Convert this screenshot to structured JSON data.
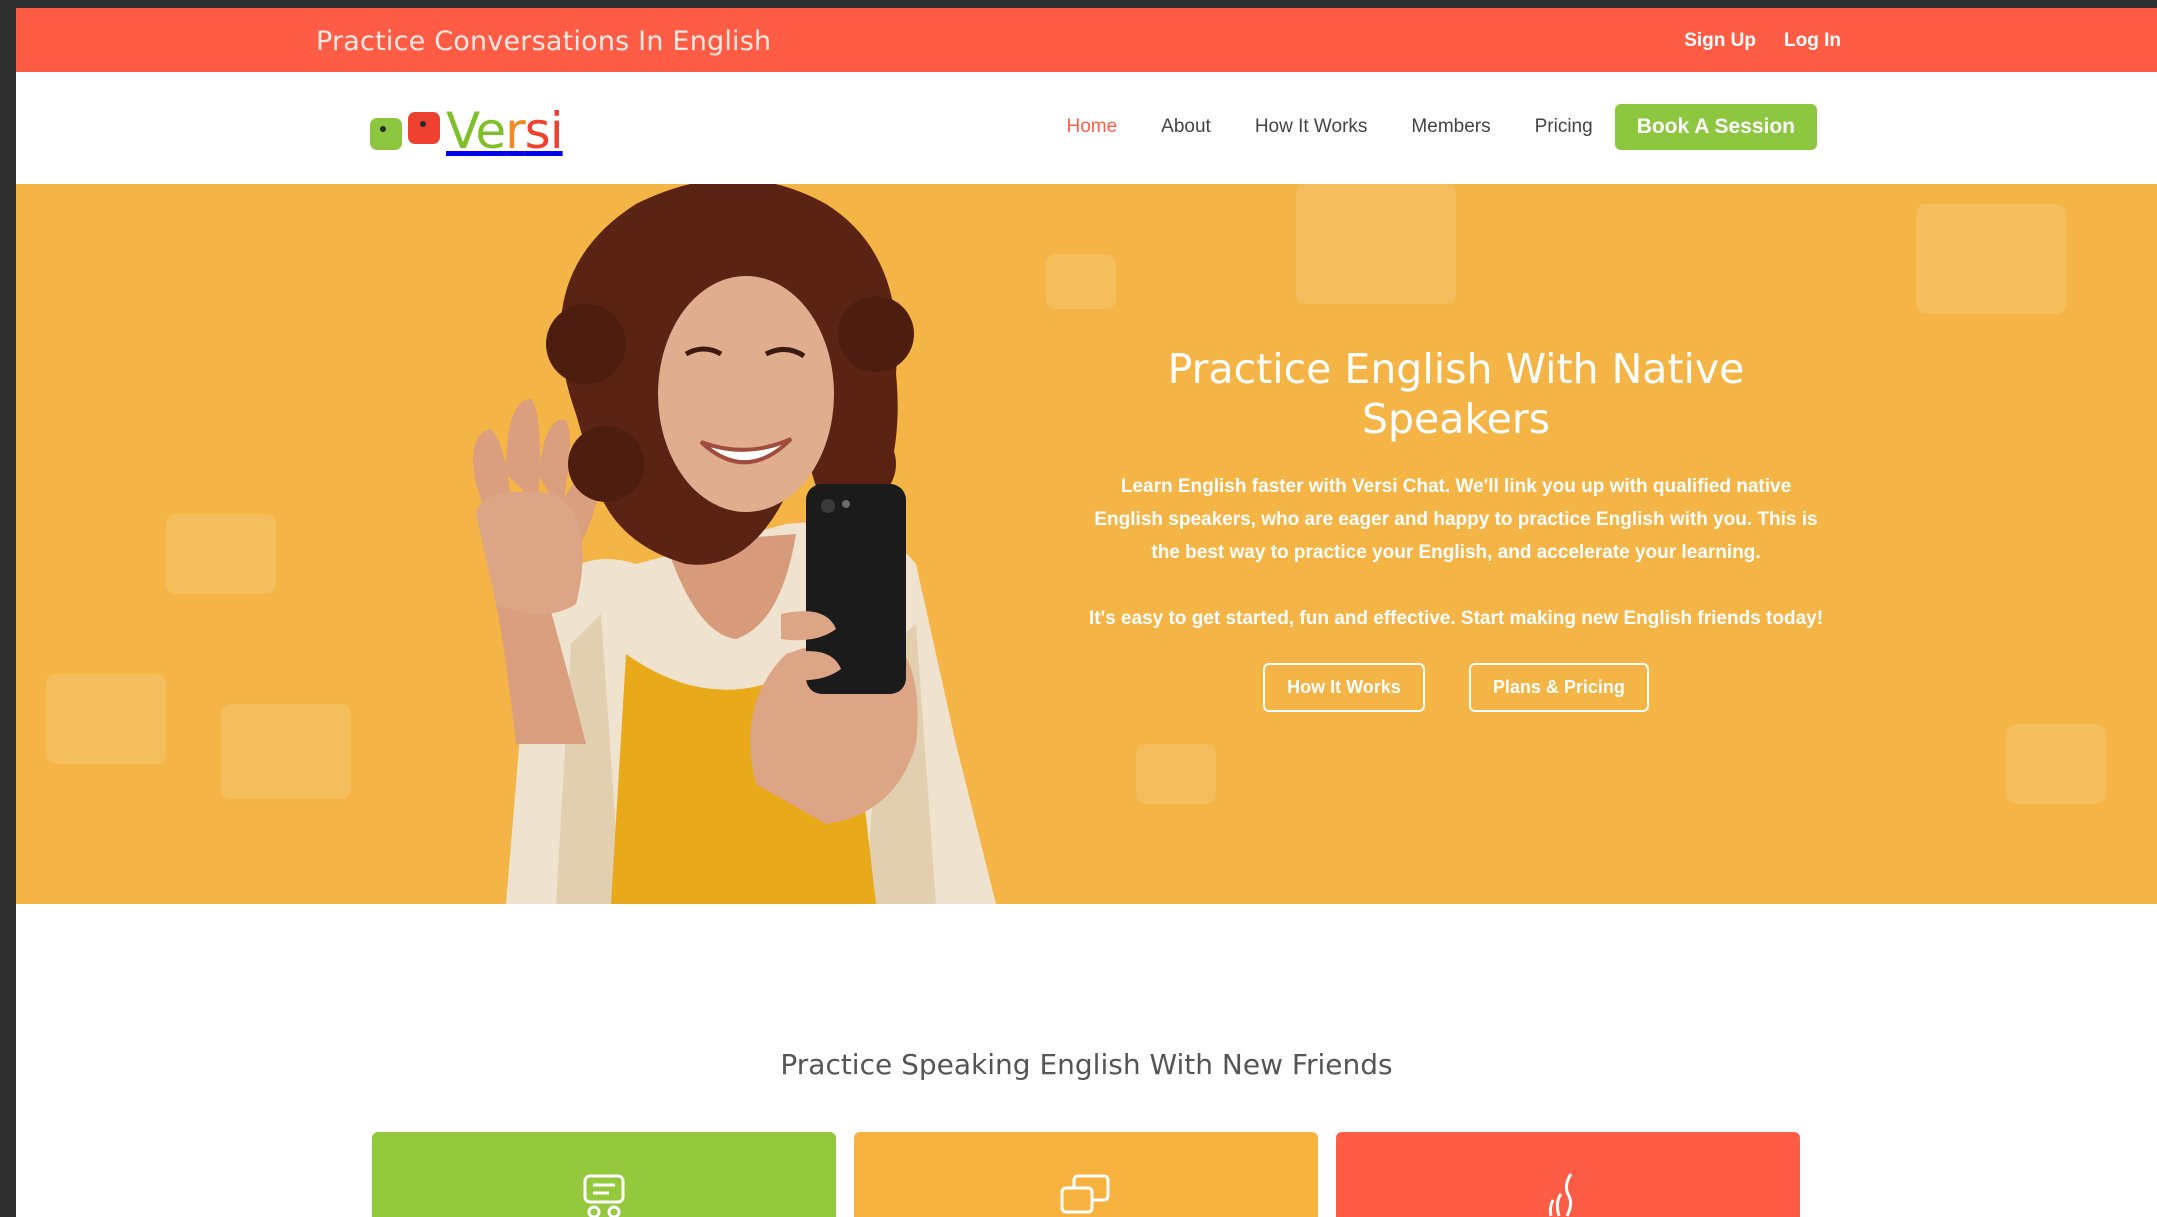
{
  "topbar": {
    "tagline": "Practice Conversations In English",
    "signup": "Sign Up",
    "login": "Log In"
  },
  "brand": {
    "name": "Versi",
    "colors": {
      "green": "#8dc63f",
      "orange": "#f08a22",
      "red": "#ee4130"
    }
  },
  "nav": {
    "items": [
      {
        "label": "Home",
        "active": true
      },
      {
        "label": "About"
      },
      {
        "label": "How It Works"
      },
      {
        "label": "Members"
      },
      {
        "label": "Pricing"
      }
    ],
    "cta": "Book A Session"
  },
  "hero": {
    "title_line1": "Practice English With Native",
    "title_line2": "Speakers",
    "para1": "Learn English faster with Versi Chat. We'll link you up with qualified native English speakers, who are eager and happy to practice English with you. This is the best way to practice your English, and accelerate your learning.",
    "para2": "It's easy to get started, fun and effective. Start making new English friends today!",
    "button1": "How It Works",
    "button2": "Plans & Pricing",
    "bg_color": "#f4b546"
  },
  "section": {
    "title": "Practice Speaking English With New Friends",
    "cards": [
      {
        "icon": "chat-bubble-icon",
        "color": "#94c83d"
      },
      {
        "icon": "conversation-icon",
        "color": "#f7b23f"
      },
      {
        "icon": "flame-icon",
        "color": "#ff5c45"
      }
    ]
  },
  "colors": {
    "topbar": "#ff5c45",
    "accent": "#8dc63f"
  }
}
